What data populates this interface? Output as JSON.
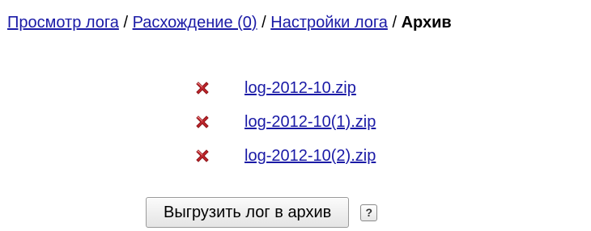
{
  "breadcrumb": {
    "items": [
      {
        "label": "Просмотр лога"
      },
      {
        "label": "Расхождение (0)"
      },
      {
        "label": "Настройки лога"
      }
    ],
    "separator": "/",
    "current": "Архив"
  },
  "archive": {
    "files": [
      {
        "name": "log-2012-10.zip",
        "icon": "delete-icon"
      },
      {
        "name": "log-2012-10(1).zip",
        "icon": "delete-icon"
      },
      {
        "name": "log-2012-10(2).zip",
        "icon": "delete-icon"
      }
    ],
    "delete_icon_color": "#c0262c"
  },
  "actions": {
    "export_label": "Выгрузить лог в архив",
    "help_label": "?"
  },
  "colors": {
    "link": "#1a1aa6",
    "text": "#000000"
  }
}
